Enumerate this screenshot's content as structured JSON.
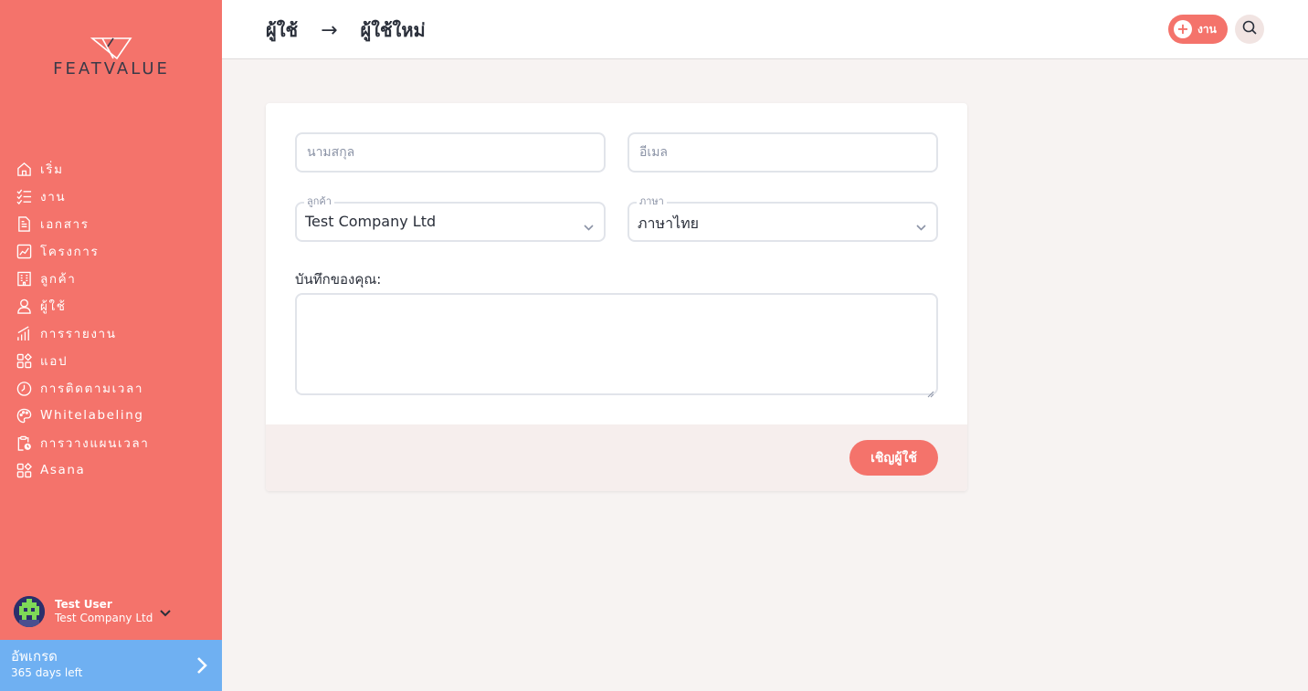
{
  "brand": {
    "name": "FEATVALUE",
    "accent": "#f4736b",
    "upgrade_color": "#6fb0f2"
  },
  "sidebar": {
    "items": [
      {
        "label": "เริ่ม",
        "icon": "home-icon"
      },
      {
        "label": "งาน",
        "icon": "checklist-icon"
      },
      {
        "label": "เอกสาร",
        "icon": "document-icon"
      },
      {
        "label": "โครงการ",
        "icon": "chart-icon"
      },
      {
        "label": "ลูกค้า",
        "icon": "building-icon"
      },
      {
        "label": "ผู้ใช้",
        "icon": "user-icon"
      },
      {
        "label": "การรายงาน",
        "icon": "bar-chart-icon"
      },
      {
        "label": "แอป",
        "icon": "apps-icon"
      },
      {
        "label": "การติดตามเวลา",
        "icon": "timer-icon"
      },
      {
        "label": "Whitelabeling",
        "icon": "palette-icon"
      },
      {
        "label": "การวางแผนเวลา",
        "icon": "clipboard-clock-icon"
      },
      {
        "label": "Asana",
        "icon": "apps-icon"
      }
    ],
    "user": {
      "name": "Test User",
      "company": "Test Company Ltd"
    },
    "upgrade": {
      "title": "อัพเกรด",
      "subtitle": "365 days left"
    }
  },
  "header": {
    "breadcrumb": {
      "parent": "ผู้ใช้",
      "separator": "→",
      "current": "ผู้ใช้ใหม่"
    },
    "task_button_label": "งาน"
  },
  "form": {
    "lastname_placeholder": "นามสกุล",
    "email_placeholder": "อีเมล",
    "customer": {
      "label": "ลูกค้า",
      "value": "Test Company Ltd"
    },
    "language": {
      "label": "ภาษา",
      "value": "ภาษาไทย"
    },
    "notes_label": "บันทึกของคุณ:",
    "invite_button": "เชิญผู้ใช้"
  }
}
